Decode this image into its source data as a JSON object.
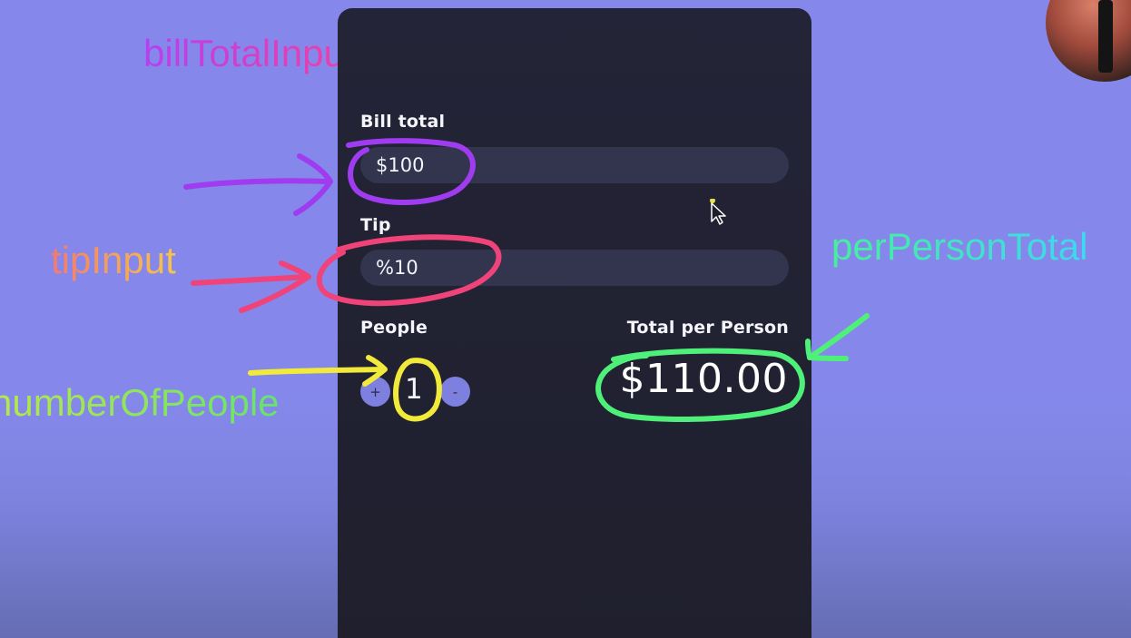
{
  "app": {
    "bill": {
      "label": "Bill total",
      "value": "$100"
    },
    "tip": {
      "label": "Tip",
      "value": "%10"
    },
    "people": {
      "label": "People",
      "increment_label": "+",
      "decrement_label": "-",
      "count": "1"
    },
    "total": {
      "label": "Total per Person",
      "value": "$110.00"
    }
  },
  "annotations": {
    "bill_total_input": "billTotalInput",
    "tip_input": "tipInput",
    "number_of_people": "numberOfPeople",
    "per_person_total": "perPersonTotal"
  },
  "colors": {
    "background": "#8588ea",
    "card": "#222335",
    "field": "#33354f",
    "button": "#7d80df",
    "annotation_bill": "#b63ff0",
    "annotation_tip": "#f0437a",
    "annotation_people": "#f2ea3a",
    "annotation_total": "#4ef07a"
  }
}
